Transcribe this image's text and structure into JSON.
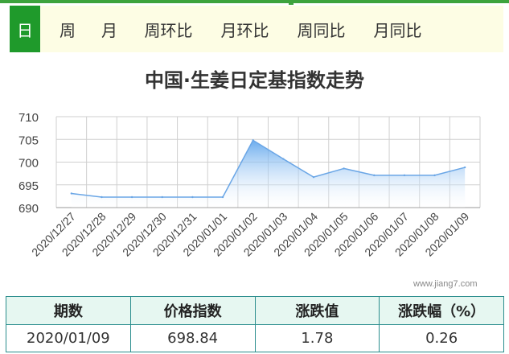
{
  "tabs": [
    {
      "label": "日",
      "active": true
    },
    {
      "label": "周",
      "active": false
    },
    {
      "label": "月",
      "active": false
    },
    {
      "label": "周环比",
      "active": false
    },
    {
      "label": "月环比",
      "active": false
    },
    {
      "label": "周同比",
      "active": false
    },
    {
      "label": "月同比",
      "active": false
    }
  ],
  "watermark": "www.jiang7.com",
  "table": {
    "headers": [
      "期数",
      "价格指数",
      "涨跌值",
      "涨跌幅（%）"
    ],
    "row": [
      "2020/01/09",
      "698.84",
      "1.78",
      "0.26"
    ]
  },
  "colors": {
    "accent_green": "#1f9a2b",
    "tab_bg": "#fdfde4",
    "line": "#6aa6e6",
    "table_border": "#2a8d8d",
    "table_header_bg": "#e6f7f1"
  },
  "chart_data": {
    "type": "area",
    "title": "中国·生姜日定基指数走势",
    "xlabel": "",
    "ylabel": "",
    "categories": [
      "2020/12/27",
      "2020/12/28",
      "2020/12/29",
      "2020/12/30",
      "2020/12/31",
      "2020/01/01",
      "2020/01/02",
      "2020/01/03",
      "2020/01/04",
      "2020/01/05",
      "2020/01/06",
      "2020/01/07",
      "2020/01/08",
      "2020/01/09"
    ],
    "values": [
      693.1,
      692.3,
      692.3,
      692.3,
      692.3,
      692.3,
      704.8,
      700.7,
      696.7,
      698.6,
      697.1,
      697.1,
      697.1,
      698.84
    ],
    "ylim": [
      690,
      710
    ],
    "yticks": [
      690,
      695,
      700,
      705,
      710
    ],
    "grid": true,
    "legend": "none"
  }
}
